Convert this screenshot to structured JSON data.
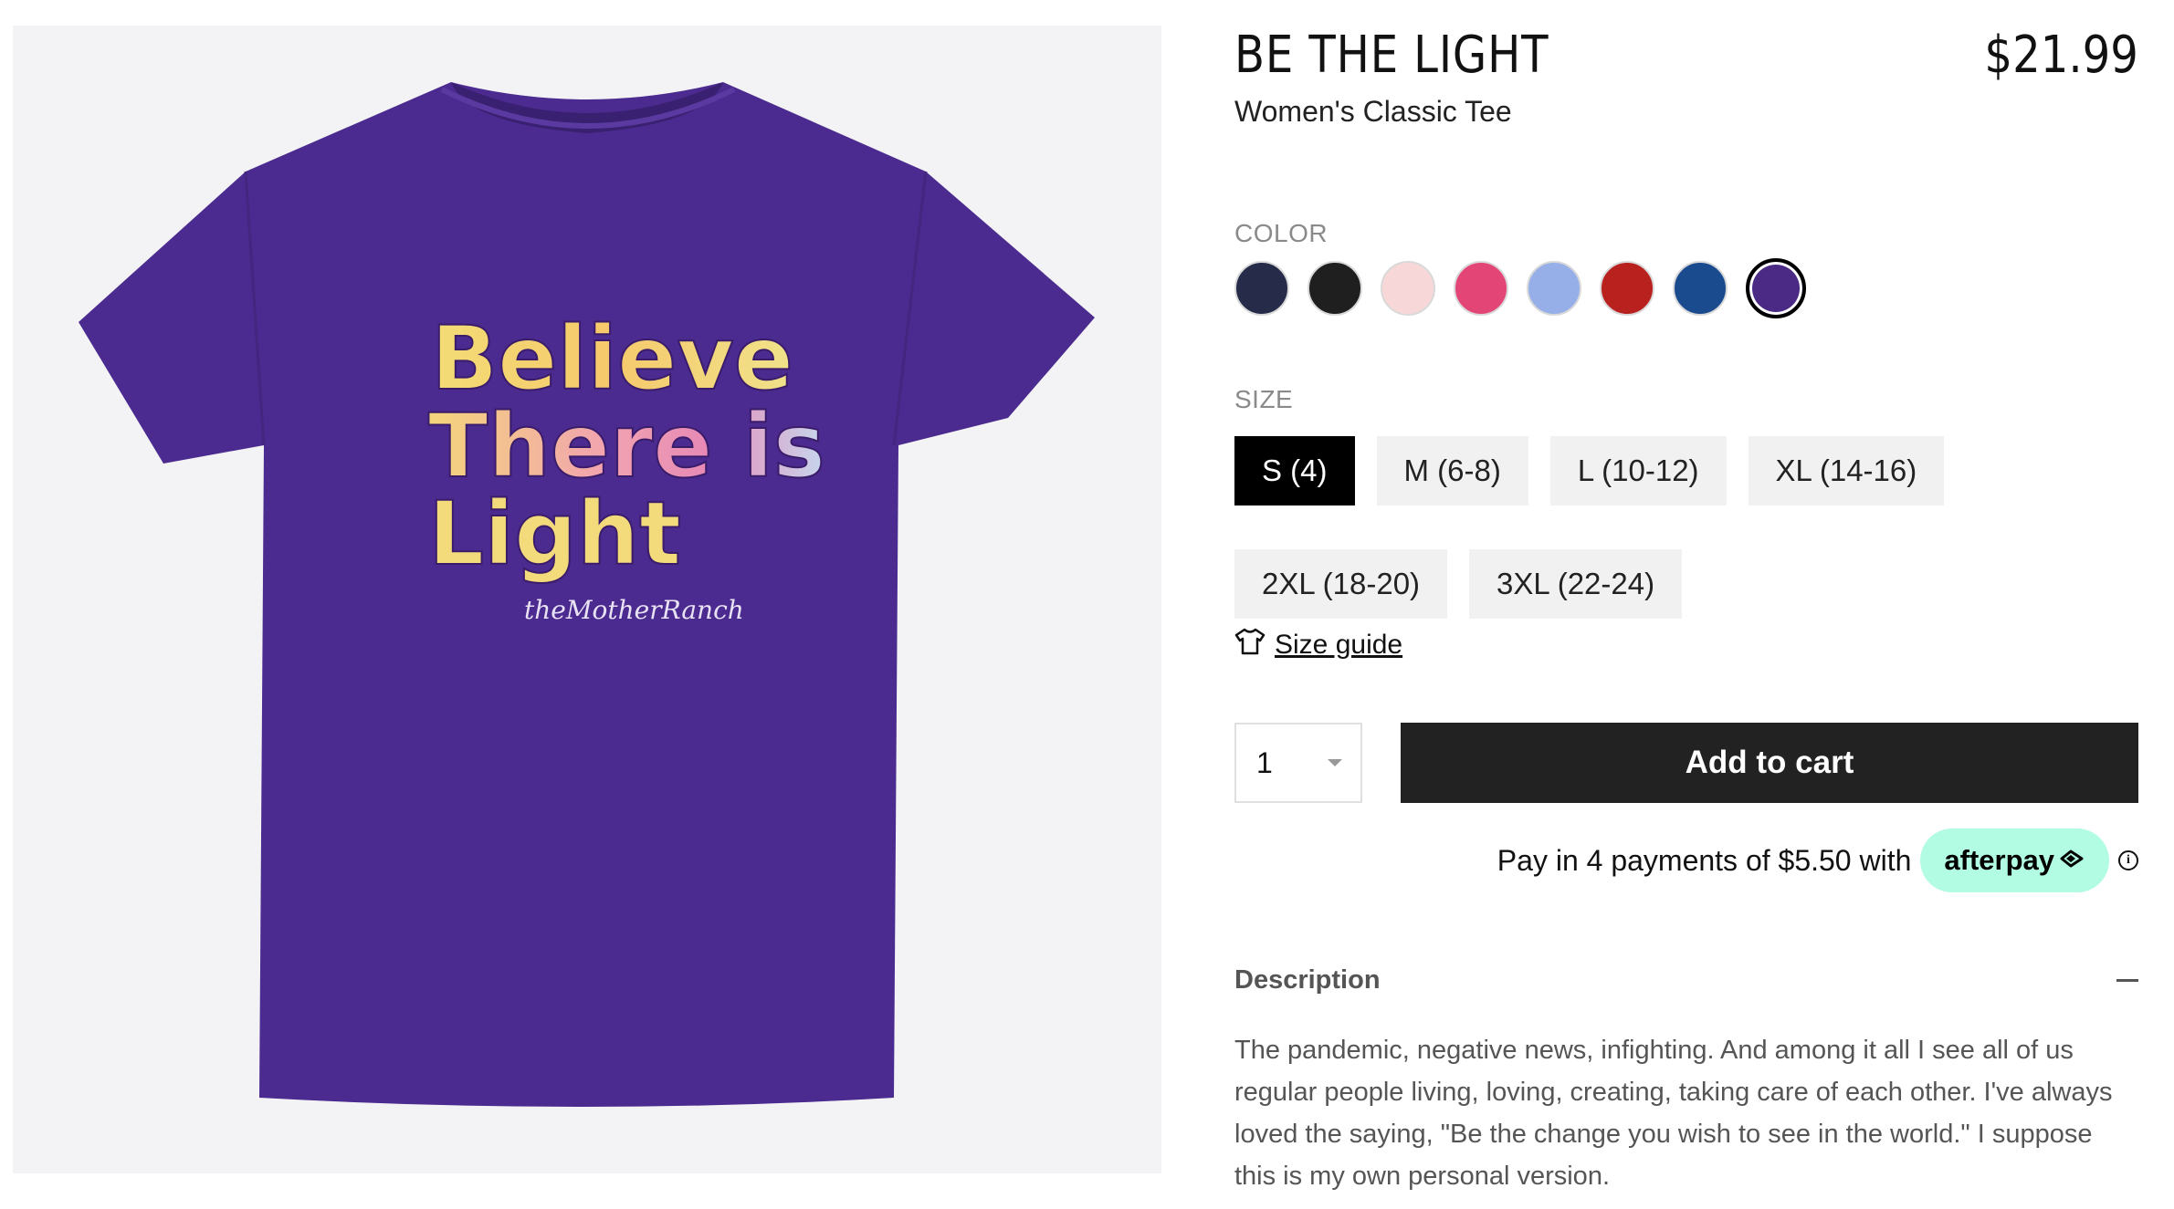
{
  "product": {
    "title": "BE THE LIGHT",
    "price": "$21.99",
    "subtitle": "Women's Classic Tee",
    "image": {
      "shirt_color": "#4b2b8f",
      "print_lines": [
        "Believe",
        "There is",
        "Light"
      ],
      "signature": "theMotherRanch"
    }
  },
  "color": {
    "label": "COLOR",
    "swatches": [
      {
        "name": "navy",
        "hex": "#252b48"
      },
      {
        "name": "black",
        "hex": "#1f1f1f"
      },
      {
        "name": "light-pink",
        "hex": "#f8d7d9"
      },
      {
        "name": "pink",
        "hex": "#e44577"
      },
      {
        "name": "light-blue",
        "hex": "#97afe9"
      },
      {
        "name": "red",
        "hex": "#b8211e"
      },
      {
        "name": "royal-blue",
        "hex": "#1b4b8f"
      },
      {
        "name": "purple",
        "hex": "#4a2a85",
        "selected": true
      }
    ]
  },
  "size": {
    "label": "SIZE",
    "options": [
      "S (4)",
      "M (6-8)",
      "L (10-12)",
      "XL (14-16)",
      "2XL (18-20)",
      "3XL (22-24)"
    ],
    "selected": "S (4)",
    "guide_label": "Size guide"
  },
  "cart": {
    "quantity": "1",
    "add_label": "Add to cart"
  },
  "afterpay": {
    "text": "Pay in 4 payments of $5.50 with",
    "brand": "afterpay",
    "info_glyph": "i"
  },
  "description": {
    "heading": "Description",
    "body": "The pandemic, negative news, infighting. And among it all I see all of us regular people living, loving, creating, taking care of each other. I've always loved the saying, \"Be the change you wish to see in the world.\" I suppose this is my own personal version."
  }
}
